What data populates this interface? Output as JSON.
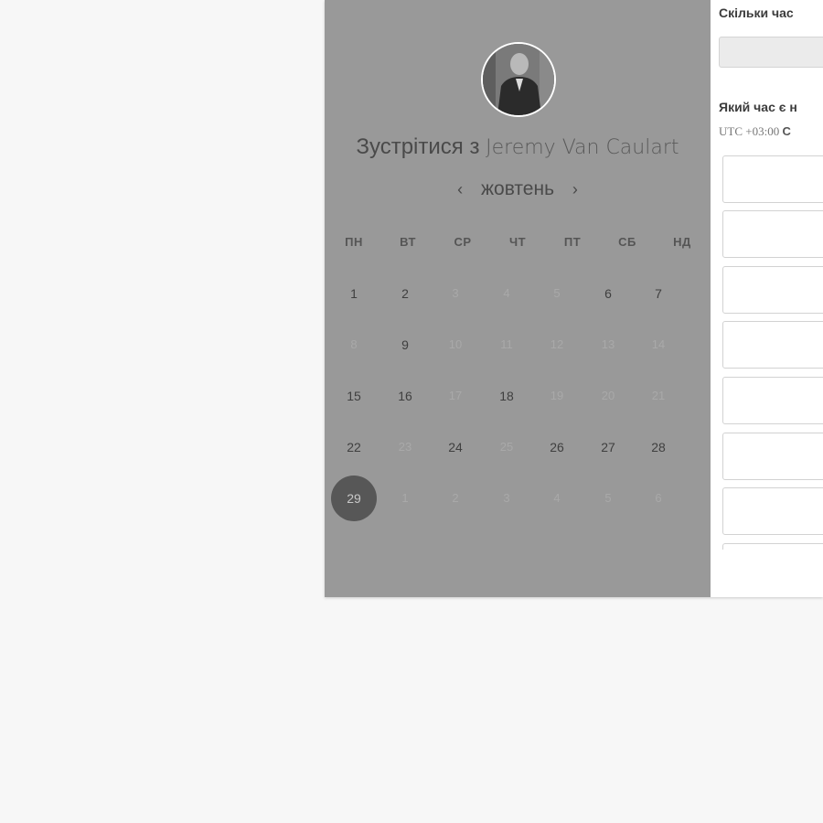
{
  "host": {
    "title_prefix": "Зустрітися з",
    "name": "Jeremy Van Caulart"
  },
  "calendar": {
    "month": "жовтень",
    "prev_arrow": "‹",
    "next_arrow": "›",
    "weekdays": [
      "ПН",
      "ВТ",
      "СР",
      "ЧТ",
      "ПТ",
      "СБ",
      "НД"
    ],
    "weeks": [
      [
        {
          "d": "1",
          "state": "available"
        },
        {
          "d": "2",
          "state": "available"
        },
        {
          "d": "3",
          "state": "disabled"
        },
        {
          "d": "4",
          "state": "disabled"
        },
        {
          "d": "5",
          "state": "disabled"
        },
        {
          "d": "6",
          "state": "available"
        },
        {
          "d": "7",
          "state": "available"
        }
      ],
      [
        {
          "d": "8",
          "state": "disabled"
        },
        {
          "d": "9",
          "state": "available"
        },
        {
          "d": "10",
          "state": "disabled"
        },
        {
          "d": "11",
          "state": "disabled"
        },
        {
          "d": "12",
          "state": "disabled"
        },
        {
          "d": "13",
          "state": "disabled"
        },
        {
          "d": "14",
          "state": "disabled"
        }
      ],
      [
        {
          "d": "15",
          "state": "available"
        },
        {
          "d": "16",
          "state": "available"
        },
        {
          "d": "17",
          "state": "disabled"
        },
        {
          "d": "18",
          "state": "available"
        },
        {
          "d": "19",
          "state": "disabled"
        },
        {
          "d": "20",
          "state": "disabled"
        },
        {
          "d": "21",
          "state": "disabled"
        }
      ],
      [
        {
          "d": "22",
          "state": "available"
        },
        {
          "d": "23",
          "state": "disabled"
        },
        {
          "d": "24",
          "state": "available"
        },
        {
          "d": "25",
          "state": "disabled"
        },
        {
          "d": "26",
          "state": "available"
        },
        {
          "d": "27",
          "state": "available"
        },
        {
          "d": "28",
          "state": "available"
        }
      ],
      [
        {
          "d": "29",
          "state": "selected"
        },
        {
          "d": "1",
          "state": "disabled"
        },
        {
          "d": "2",
          "state": "disabled"
        },
        {
          "d": "3",
          "state": "disabled"
        },
        {
          "d": "4",
          "state": "disabled"
        },
        {
          "d": "5",
          "state": "disabled"
        },
        {
          "d": "6",
          "state": "disabled"
        }
      ]
    ]
  },
  "booking": {
    "duration_label": "Скільки час",
    "time_label": "Який час є н",
    "timezone_prefix": "UTC +03:00",
    "timezone_rest": "C"
  },
  "colors": {
    "page_background": "#f7f7f7",
    "left_panel": "#999999",
    "selected_day": "#575757"
  }
}
